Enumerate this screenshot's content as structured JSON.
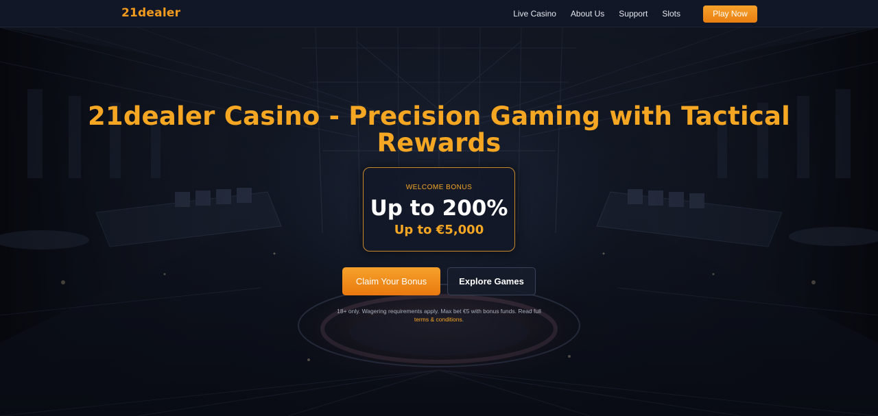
{
  "nav": {
    "logo": "21dealer",
    "links": [
      "Live Casino",
      "About Us",
      "Support",
      "Slots"
    ],
    "cta": "Play Now"
  },
  "hero": {
    "headline": "21dealer Casino - Precision Gaming with Tactical Rewards",
    "bonus": {
      "label": "WELCOME BONUS",
      "main": "Up to 200%",
      "sub": "Up to €5,000"
    },
    "buttons": {
      "claim": "Claim Your Bonus",
      "explore": "Explore Games"
    },
    "disclaimer": {
      "text": "18+ only. Wagering requirements apply. Max bet €5 with bonus funds. Read full",
      "link": "terms & conditions",
      "end": "."
    }
  },
  "colors": {
    "accent": "#f5a623",
    "nav_bg": "#111726",
    "page_bg": "#0d1220"
  }
}
